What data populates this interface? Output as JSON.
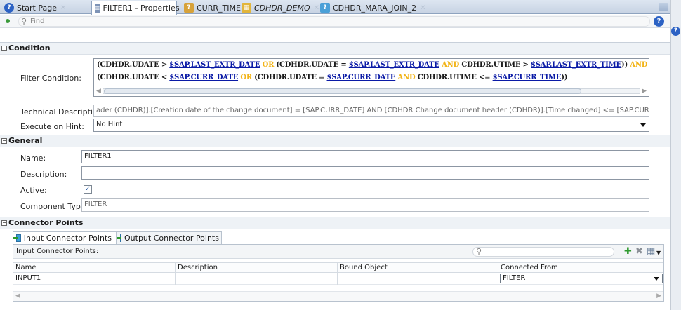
{
  "tabs": [
    {
      "label": "Start Page",
      "icon": "help-icon"
    },
    {
      "label": "FILTER1 - Properties",
      "icon": "properties-icon"
    },
    {
      "label": "CURR_TIME",
      "icon": "variable-icon"
    },
    {
      "label": "CDHDR_DEMO",
      "icon": "table-icon"
    },
    {
      "label": "CDHDR_MARA_JOIN_2",
      "icon": "join-icon"
    }
  ],
  "find": {
    "placeholder": "Find"
  },
  "condition": {
    "section_title": "Condition",
    "filter_label": "Filter Condition:",
    "filter_line1": [
      {
        "t": "(CDHDR.UDATE > ",
        "c": "n"
      },
      {
        "t": "$SAP.LAST_EXTR_DATE",
        "c": "v"
      },
      {
        "t": " OR ",
        "c": "k"
      },
      {
        "t": "(CDHDR.UDATE = ",
        "c": "n"
      },
      {
        "t": "$SAP.LAST_EXTR_DATE",
        "c": "v"
      },
      {
        "t": " AND ",
        "c": "k"
      },
      {
        "t": "CDHDR.UTIME > ",
        "c": "n"
      },
      {
        "t": "$SAP.LAST_EXTR_TIME",
        "c": "v"
      },
      {
        "t": ")) ",
        "c": "n"
      },
      {
        "t": "AND",
        "c": "k"
      }
    ],
    "filter_line2": [
      {
        "t": "(CDHDR.UDATE < ",
        "c": "n"
      },
      {
        "t": "$SAP.CURR_DATE",
        "c": "v"
      },
      {
        "t": " OR ",
        "c": "k"
      },
      {
        "t": "(CDHDR.UDATE = ",
        "c": "n"
      },
      {
        "t": "$SAP.CURR_DATE",
        "c": "v"
      },
      {
        "t": " AND ",
        "c": "k"
      },
      {
        "t": "CDHDR.UTIME <= ",
        "c": "n"
      },
      {
        "t": "$SAP.CURR_TIME",
        "c": "v"
      },
      {
        "t": "))",
        "c": "n"
      }
    ],
    "tech_label": "Technical Description:",
    "tech_value": "ader (CDHDR)].[Creation date of the change document] = [SAP.CURR_DATE]  AND [CDHDR  Change document header (CDHDR)].[Time changed] <= [SAP.CURR_TIME]))",
    "hint_label": "Execute on Hint:",
    "hint_value": "No Hint"
  },
  "general": {
    "section_title": "General",
    "name_label": "Name:",
    "name_value": "FILTER1",
    "desc_label": "Description:",
    "desc_value": "",
    "active_label": "Active:",
    "active_checked": true,
    "type_label": "Component Type:",
    "type_value": "FILTER"
  },
  "connectors": {
    "section_title": "Connector Points",
    "tab_input": "Input Connector Points",
    "tab_output": "Output Connector Points",
    "toolbar_label": "Input Connector Points:",
    "columns": [
      "Name",
      "Description",
      "Bound Object",
      "Connected From"
    ],
    "rows": [
      {
        "name": "INPUT1",
        "description": "",
        "bound_object": "",
        "connected_from": "FILTER"
      }
    ]
  },
  "colors": {
    "keyword": "#f2b418",
    "variable": "#0a1aa6",
    "accent": "#2c62c4"
  }
}
